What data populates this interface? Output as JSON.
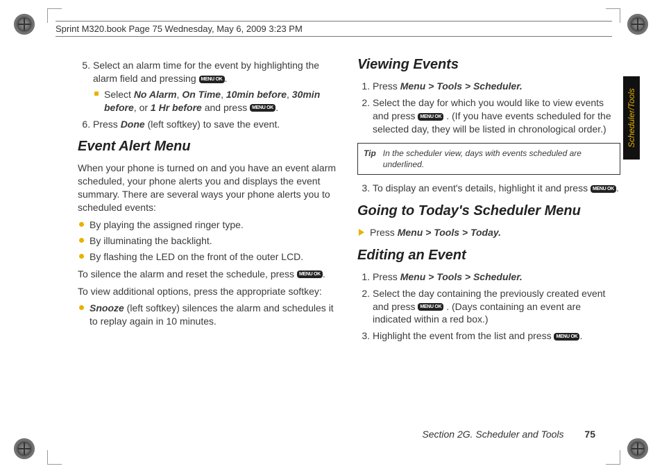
{
  "doc_header": "Sprint M320.book  Page 75  Wednesday, May 6, 2009  3:23 PM",
  "side_tab": "Scheduler/Tools",
  "menu_key_label": "MENU OK",
  "left": {
    "step5": "Select an alarm time for the event by highlighting the alarm field and pressing ",
    "step5_sub_prefix": "Select ",
    "opts": {
      "a": "No Alarm",
      "b": "On Time",
      "c": "10min before",
      "d": "30min before",
      "e": "1 Hr before"
    },
    "step5_sub_mid": " and press ",
    "step6_a": "Press ",
    "step6_done": "Done",
    "step6_b": " (left softkey) to save the event.",
    "h_event_alert": "Event Alert Menu",
    "p_intro": "When your phone is turned on and you have an event alarm scheduled, your phone alerts you and displays the event summary. There are several ways your phone alerts you to scheduled events:",
    "b1": "By playing the assigned ringer type.",
    "b2": "By illuminating the backlight.",
    "b3": "By flashing the LED on the front of the outer LCD.",
    "p_silence": "To silence the alarm and reset the schedule, press ",
    "p_options": "To view additional options, press the appropriate softkey:",
    "snooze_label": "Snooze",
    "snooze_rest": " (left softkey) silences the alarm and schedules it to replay again in 10 minutes."
  },
  "right": {
    "h_viewing": "Viewing Events",
    "v1_a": "Press ",
    "v1_path": "Menu > Tools > Scheduler.",
    "v2_a": "Select the day for which you would like to view events and press ",
    "v2_b": ". (If you have events scheduled for the selected day, they will be listed in chronological order.)",
    "tip_label": "Tip",
    "tip_text": "In the scheduler view, days with events scheduled are underlined.",
    "v3_a": "To display an event's details, highlight it and press ",
    "h_today": "Going to Today's Scheduler Menu",
    "today_a": "Press ",
    "today_path": "Menu > Tools > Today.",
    "h_edit": "Editing an Event",
    "e1_a": "Press ",
    "e1_path": "Menu > Tools > Scheduler.",
    "e2_a": "Select the day containing the previously created event and press ",
    "e2_b": ". (Days containing an event are indicated within a red box.)",
    "e3_a": "Highlight the event from the list and press "
  },
  "footer": {
    "section": "Section 2G. Scheduler and Tools",
    "page": "75"
  }
}
